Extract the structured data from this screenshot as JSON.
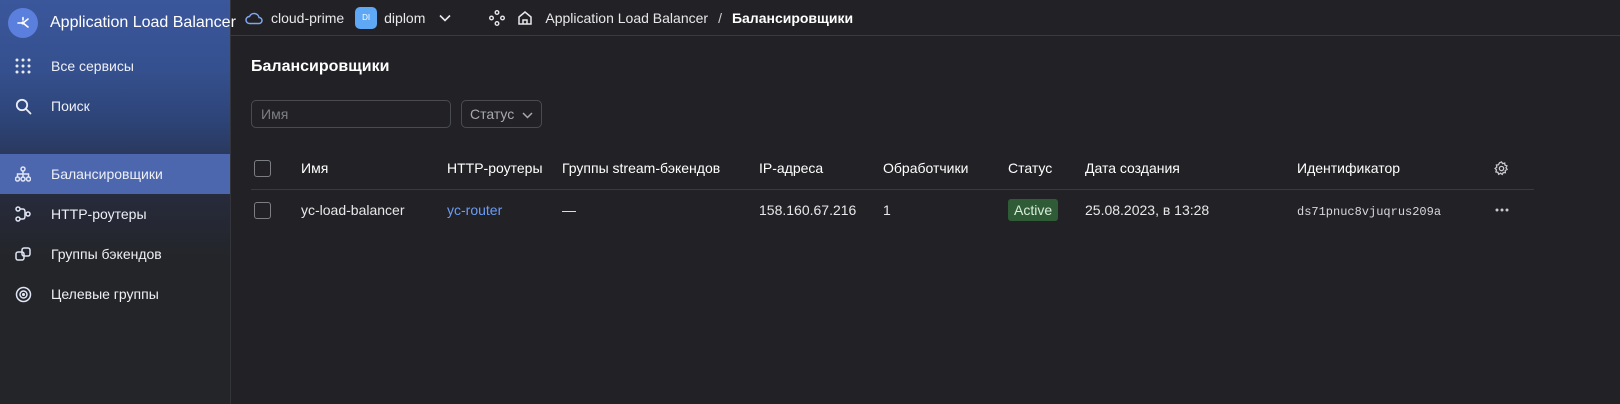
{
  "sidebar": {
    "service_title": "Application Load Balancer",
    "top_items": [
      {
        "label": "Все сервисы",
        "icon": "grid-icon"
      },
      {
        "label": "Поиск",
        "icon": "search-icon"
      }
    ],
    "nav_items": [
      {
        "label": "Балансировщики",
        "icon": "balancer-icon",
        "active": true
      },
      {
        "label": "HTTP-роутеры",
        "icon": "router-icon",
        "active": false
      },
      {
        "label": "Группы бэкендов",
        "icon": "backend-groups-icon",
        "active": false
      },
      {
        "label": "Целевые группы",
        "icon": "target-icon",
        "active": false
      }
    ]
  },
  "topbar": {
    "cloud_name": "cloud-prime",
    "folder_badge": "DI",
    "folder_name": "diplom",
    "breadcrumb_service": "Application Load Balancer",
    "breadcrumb_separator": "/",
    "breadcrumb_current": "Балансировщики"
  },
  "page": {
    "title": "Балансировщики",
    "name_placeholder": "Имя",
    "status_filter_label": "Статус"
  },
  "table": {
    "columns": [
      "Имя",
      "HTTP-роутеры",
      "Группы stream-бэкендов",
      "IP-адреса",
      "Обработчики",
      "Статус",
      "Дата создания",
      "Идентификатор"
    ],
    "rows": [
      {
        "name": "yc-load-balancer",
        "http_router": "yc-router",
        "stream_groups": "—",
        "ip": "158.160.67.216",
        "handlers": "1",
        "status": "Active",
        "created": "25.08.2023, в 13:28",
        "id": "ds71pnuc8vjuqrus209a"
      }
    ]
  },
  "colors": {
    "accent": "#4c67ad",
    "link": "#6a9cf6",
    "status_active_bg": "#2f5c37",
    "folder_badge": "#5ea8f5"
  }
}
